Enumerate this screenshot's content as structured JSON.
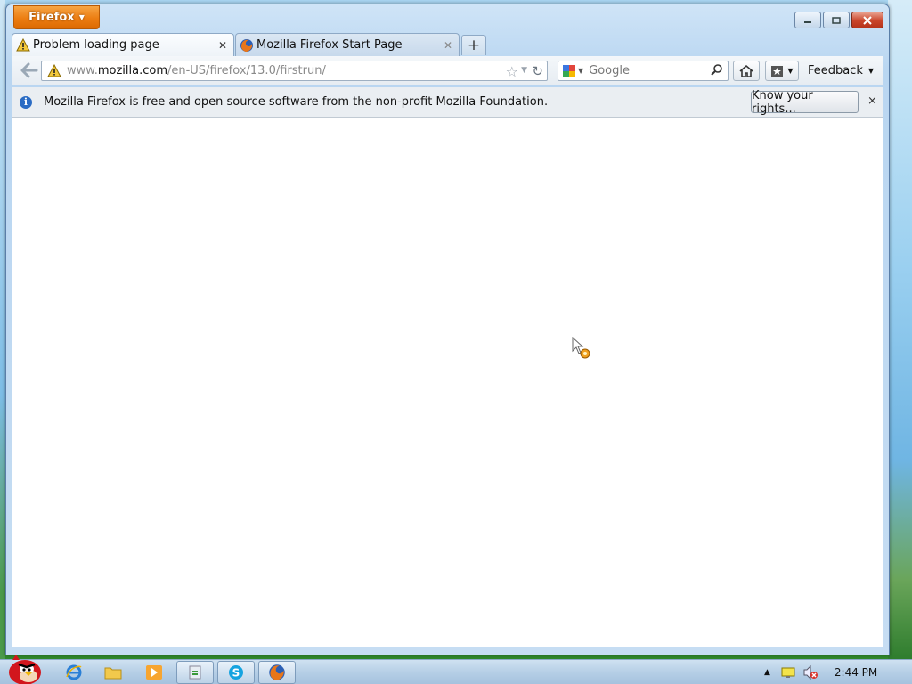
{
  "window": {
    "app_button_label": "Firefox",
    "caption_buttons": [
      "minimize",
      "maximize",
      "close"
    ]
  },
  "tabs": [
    {
      "label": "Problem loading page",
      "icon": "warning-icon",
      "active": true
    },
    {
      "label": "Mozilla Firefox Start Page",
      "icon": "firefox-icon",
      "active": false
    }
  ],
  "new_tab_label": "+",
  "navbar": {
    "url_host": "www.mozilla.com",
    "url_path": "/en-US/firefox/13.0/firstrun/",
    "url_prefix": "www.",
    "url_domain": "mozilla.com",
    "search_placeholder": "Google",
    "feedback_label": "Feedback"
  },
  "notification": {
    "message": "Mozilla Firefox is free and open source software from the non-profit Mozilla Foundation.",
    "button_label": "Know your rights...",
    "close_label": "×"
  },
  "taskbar": {
    "clock": "2:44 PM"
  },
  "colors": {
    "firefox_orange": "#ec7d12",
    "close_red": "#c9442a",
    "info_blue": "#2b6cc4"
  }
}
